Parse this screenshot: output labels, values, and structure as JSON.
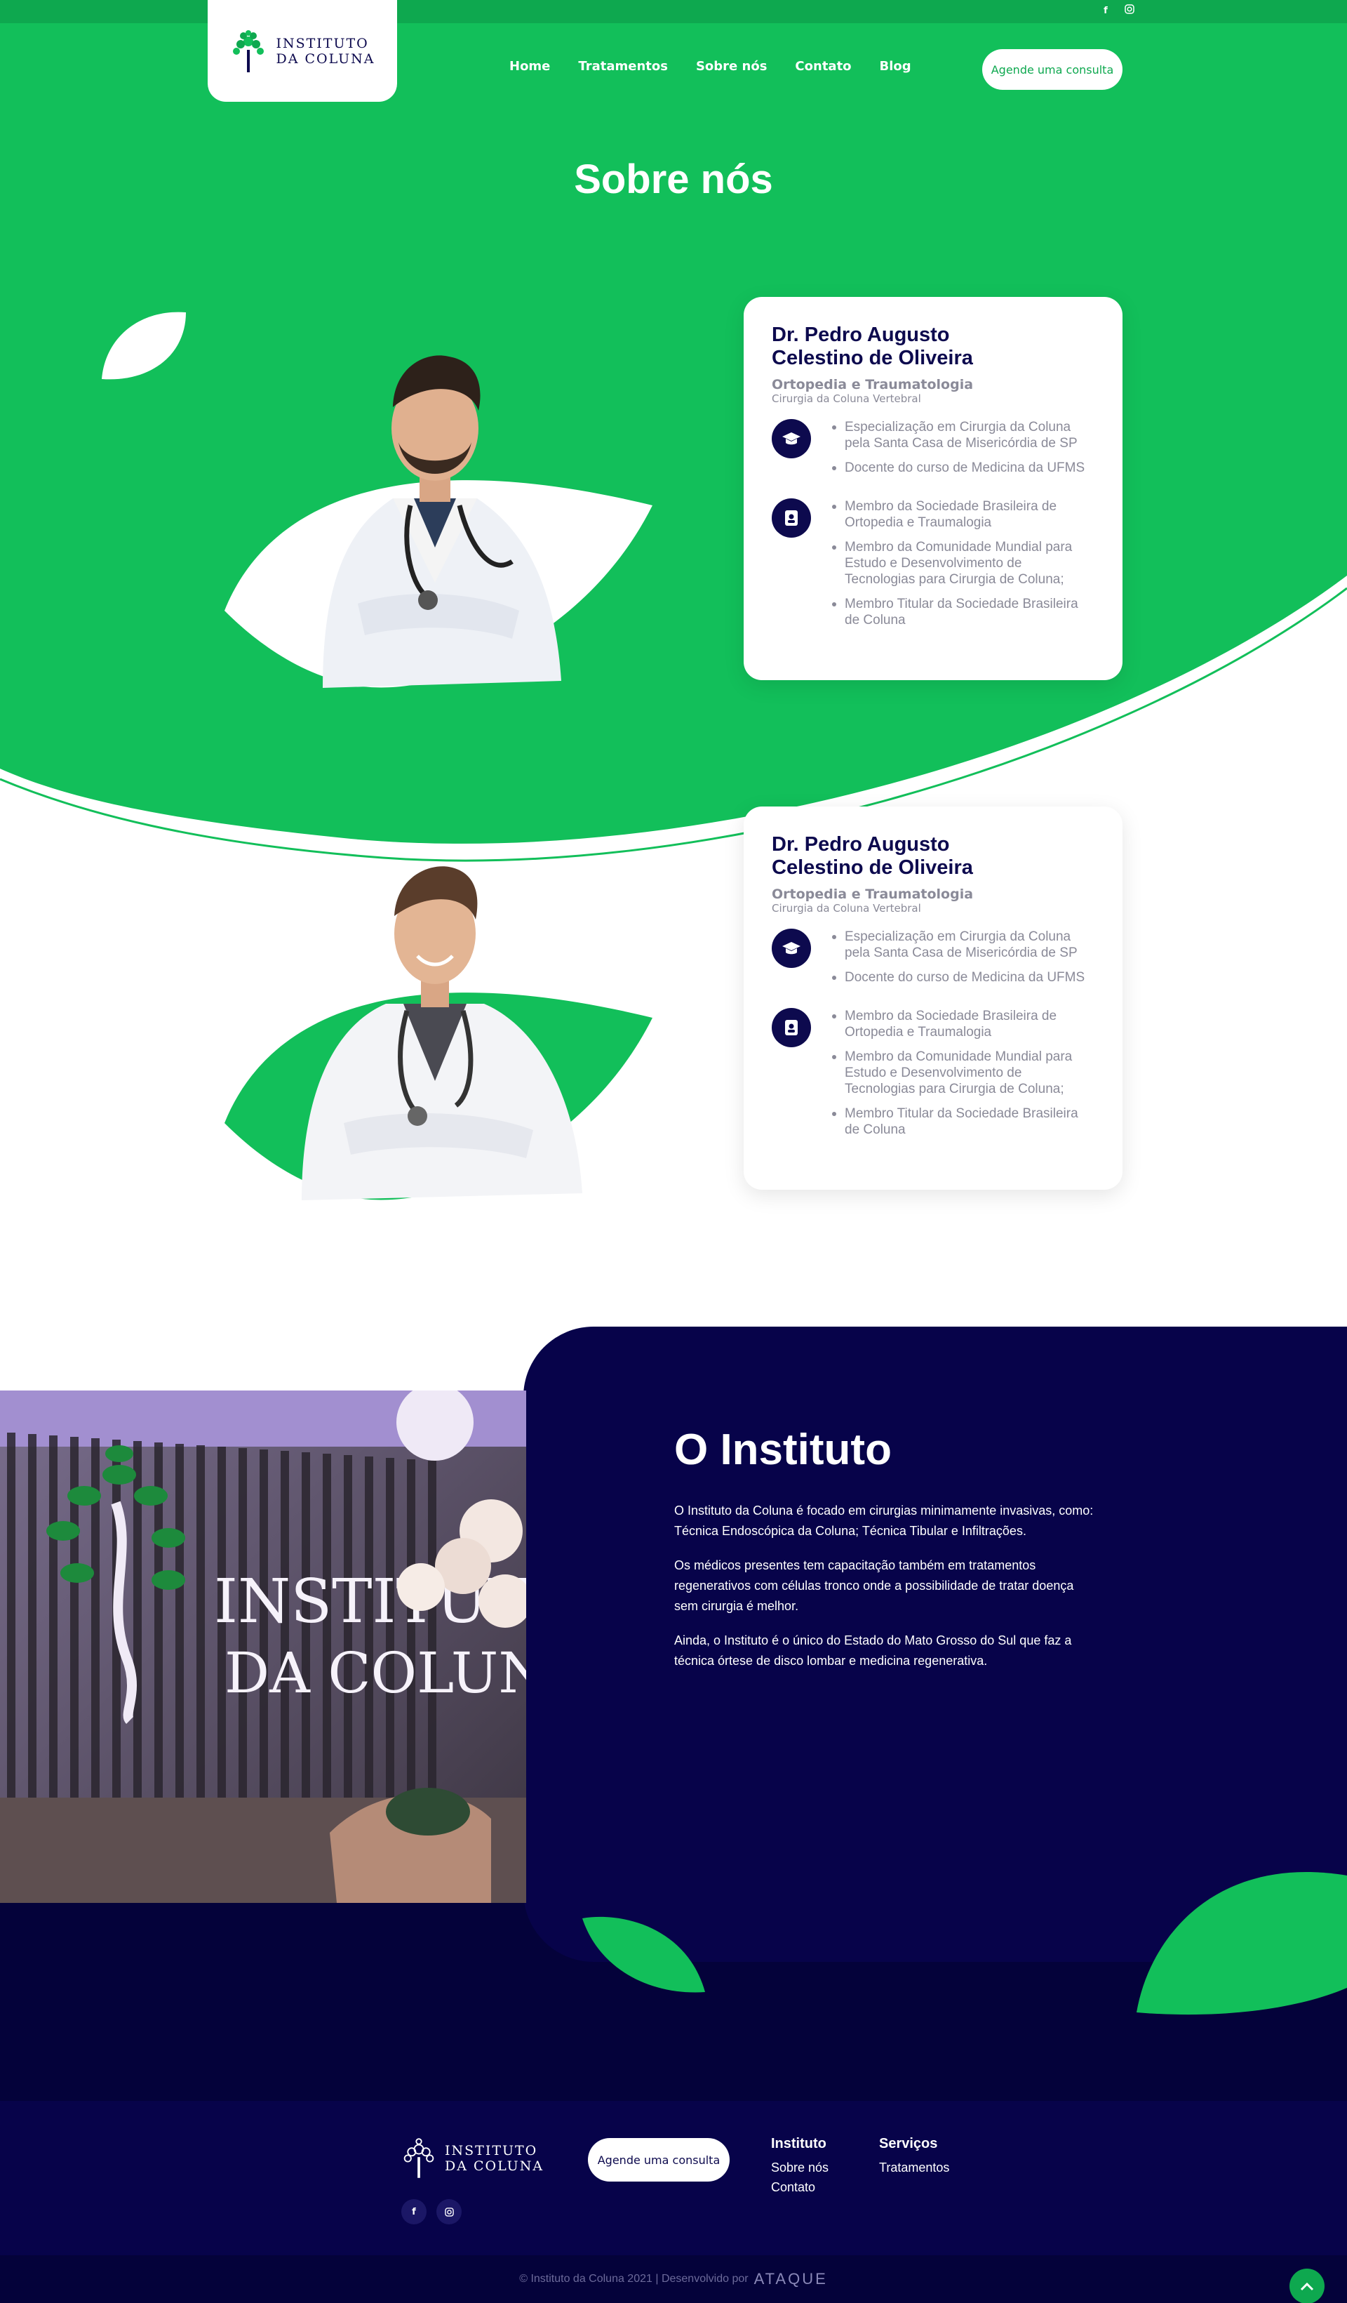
{
  "colors": {
    "green": "#12bf5a",
    "dark_green": "#0ea84f",
    "navy": "#07034a",
    "white": "#ffffff"
  },
  "top_social": [
    "facebook-icon",
    "instagram-icon"
  ],
  "brand": {
    "line1": "INSTITUTO",
    "line2": "DA COLUNA"
  },
  "nav": {
    "home": "Home",
    "tratamentos": "Tratamentos",
    "sobre": "Sobre nós",
    "contato": "Contato",
    "blog": "Blog"
  },
  "cta": "Agende uma consulta",
  "page_title": "Sobre nós",
  "doctors": [
    {
      "name_line1": "Dr. Pedro Augusto",
      "name_line2": "Celestino de Oliveira",
      "specialty": "Ortopedia e Traumatologia",
      "subspecialty": "Cirurgia da Coluna Vertebral",
      "education": [
        "Especialização em Cirurgia da Coluna pela Santa Casa de Misericórdia de SP",
        "Docente do curso de Medicina da UFMS"
      ],
      "memberships": [
        "Membro da Sociedade Brasileira de Ortopedia e Traumalogia",
        "Membro da Comunidade Mundial para Estudo e Desenvolvimento de Tecnologias para Cirurgia de Coluna;",
        "Membro Titular da Sociedade Brasileira de Coluna"
      ]
    },
    {
      "name_line1": "Dr. Pedro Augusto",
      "name_line2": "Celestino de Oliveira",
      "specialty": "Ortopedia e Traumatologia",
      "subspecialty": "Cirurgia da Coluna Vertebral",
      "education": [
        "Especialização em Cirurgia da Coluna pela Santa Casa de Misericórdia de SP",
        "Docente do curso de Medicina da UFMS"
      ],
      "memberships": [
        "Membro da Sociedade Brasileira de Ortopedia e Traumalogia",
        "Membro da Comunidade Mundial para Estudo e Desenvolvimento de Tecnologias para Cirurgia de Coluna;",
        "Membro Titular da Sociedade Brasileira de Coluna"
      ]
    }
  ],
  "instituto": {
    "title": "O Instituto",
    "p1": "O Instituto da Coluna é focado em cirurgias minimamente invasivas, como: Técnica Endoscópica da Coluna; Técnica Tibular e Infiltrações.",
    "p2": "Os médicos presentes tem capacitação também em tratamentos regenerativos com células tronco onde a possibilidade de tratar doença sem cirurgia é melhor.",
    "p3": "Ainda, o Instituto é o único do Estado do Mato Grosso do Sul que faz a técnica órtese de disco lombar e medicina regenerativa.",
    "sign_line1": "INSTITUTO",
    "sign_line2": "DA COLUNA"
  },
  "footer": {
    "col1_title": "Instituto",
    "col1_links": [
      "Sobre nós",
      "Contato"
    ],
    "col2_title": "Serviços",
    "col2_links": [
      "Tratamentos"
    ],
    "copyright": "© Instituto da Coluna 2021 | Desenvolvido por",
    "dev_brand": "ATAQUE"
  }
}
